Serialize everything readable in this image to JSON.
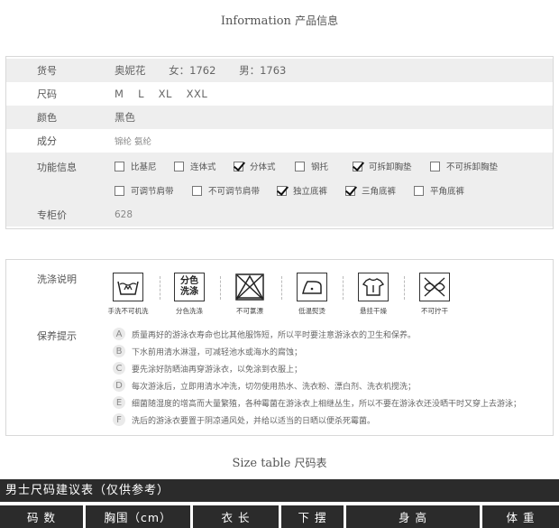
{
  "info_title": {
    "en": "Information",
    "zh": "产品信息"
  },
  "info": {
    "item_no": {
      "label": "货号",
      "brand": "奥妮花",
      "women": "女：1762",
      "men": "男：1763"
    },
    "size": {
      "label": "尺码",
      "values": [
        "M",
        "L",
        "XL",
        "XXL"
      ]
    },
    "color": {
      "label": "颜色",
      "value": "黑色"
    },
    "material": {
      "label": "成分",
      "value": "锦纶 氨纶"
    },
    "features": {
      "label": "功能信息",
      "options": [
        {
          "label": "比基尼",
          "checked": false
        },
        {
          "label": "连体式",
          "checked": false
        },
        {
          "label": "分体式",
          "checked": true
        },
        {
          "label": "钢托",
          "checked": false
        },
        {
          "label": "可拆卸胸垫",
          "checked": true
        },
        {
          "label": "不可拆卸胸垫",
          "checked": false
        },
        {
          "label": "可调节肩带",
          "checked": false
        },
        {
          "label": "不可调节肩带",
          "checked": false
        },
        {
          "label": "独立底裤",
          "checked": true
        },
        {
          "label": "三角底裤",
          "checked": true
        },
        {
          "label": "平角底裤",
          "checked": false
        }
      ]
    },
    "price": {
      "label": "专柜价",
      "value": "628"
    }
  },
  "care": {
    "wash_label": "洗涤说明",
    "icons": [
      {
        "name": "hand-wash-icon",
        "caption": "手洗不可机洗"
      },
      {
        "name": "separate-wash-icon",
        "caption": "分色洗涤",
        "text_top": "分色",
        "text_bottom": "洗涤"
      },
      {
        "name": "no-bleach-icon",
        "caption": "不可氯漂"
      },
      {
        "name": "low-iron-icon",
        "caption": "低温熨烫"
      },
      {
        "name": "hang-dry-icon",
        "caption": "悬挂干燥"
      },
      {
        "name": "no-wring-icon",
        "caption": "不可拧干"
      }
    ],
    "tips_label": "保养提示",
    "tips": [
      {
        "letter": "A",
        "text": "质量再好的游泳衣寿命也比其他服饰短，所以平时要注意游泳衣的卫生和保养。"
      },
      {
        "letter": "B",
        "text": "下水前用清水淋湿，可减轻池水或海水的腐蚀；"
      },
      {
        "letter": "C",
        "text": "要先涂好防晒油再穿游泳衣，以免涂到衣服上；"
      },
      {
        "letter": "D",
        "text": "每次游泳后，立即用清水冲洗，切勿使用热水、洗衣粉、漂白剂、洗衣机搅洗；"
      },
      {
        "letter": "E",
        "text": "细菌随湿度的增高而大量繁殖，各种霉菌在游泳衣上相继丛生，所以不要在游泳衣还没晒干时又穿上去游泳；"
      },
      {
        "letter": "F",
        "text": "洗后的游泳衣要置于阴凉通风处，并给以适当的日晒以便杀死霉菌。"
      }
    ]
  },
  "size_title": {
    "en": "Size table",
    "zh": "尺码表"
  },
  "size_table": {
    "header": "男士尺码建议表（仅供参考）",
    "columns": [
      "码 数",
      "胸围（cm）",
      "衣 长",
      "下 摆",
      "身 高",
      "体 重"
    ]
  }
}
